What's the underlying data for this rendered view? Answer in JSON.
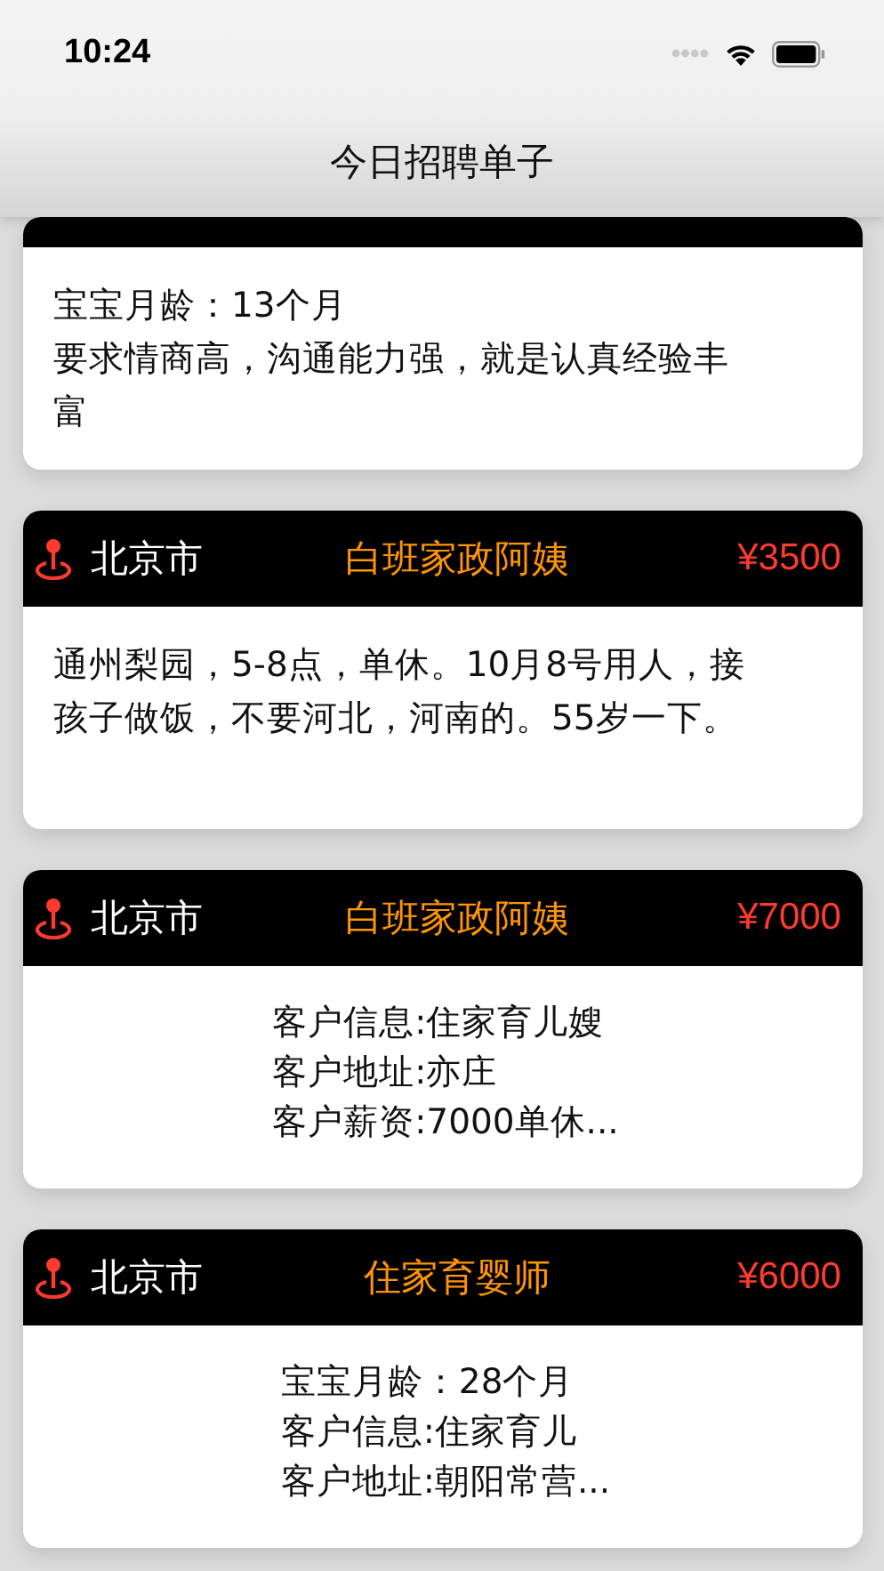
{
  "status_bar": {
    "time": "10:24"
  },
  "nav": {
    "title": "今日招聘单子"
  },
  "cards": [
    {
      "kind": "plain",
      "lines": [
        "宝宝月龄：13个月",
        "要求情商高，沟通能力强，就是认真经验丰",
        "富"
      ]
    },
    {
      "city": "北京市",
      "title": "白班家政阿姨",
      "price": "¥3500",
      "kind": "plain",
      "lines": [
        "通州梨园，5-8点，单休。10月8号用人，接",
        "孩子做饭，不要河北，河南的。55岁一下。"
      ]
    },
    {
      "city": "北京市",
      "title": "白班家政阿姨",
      "price": "¥7000",
      "kind": "centered",
      "lines": [
        "客户信息:住家育儿嫂",
        "客户地址:亦庄",
        "客户薪资:7000单休..."
      ]
    },
    {
      "city": "北京市",
      "title": "住家育婴师",
      "price": "¥6000",
      "kind": "centered",
      "lines": [
        "宝宝月龄：28个月",
        "客户信息:住家育儿",
        "客户地址:朝阳常营..."
      ]
    }
  ]
}
